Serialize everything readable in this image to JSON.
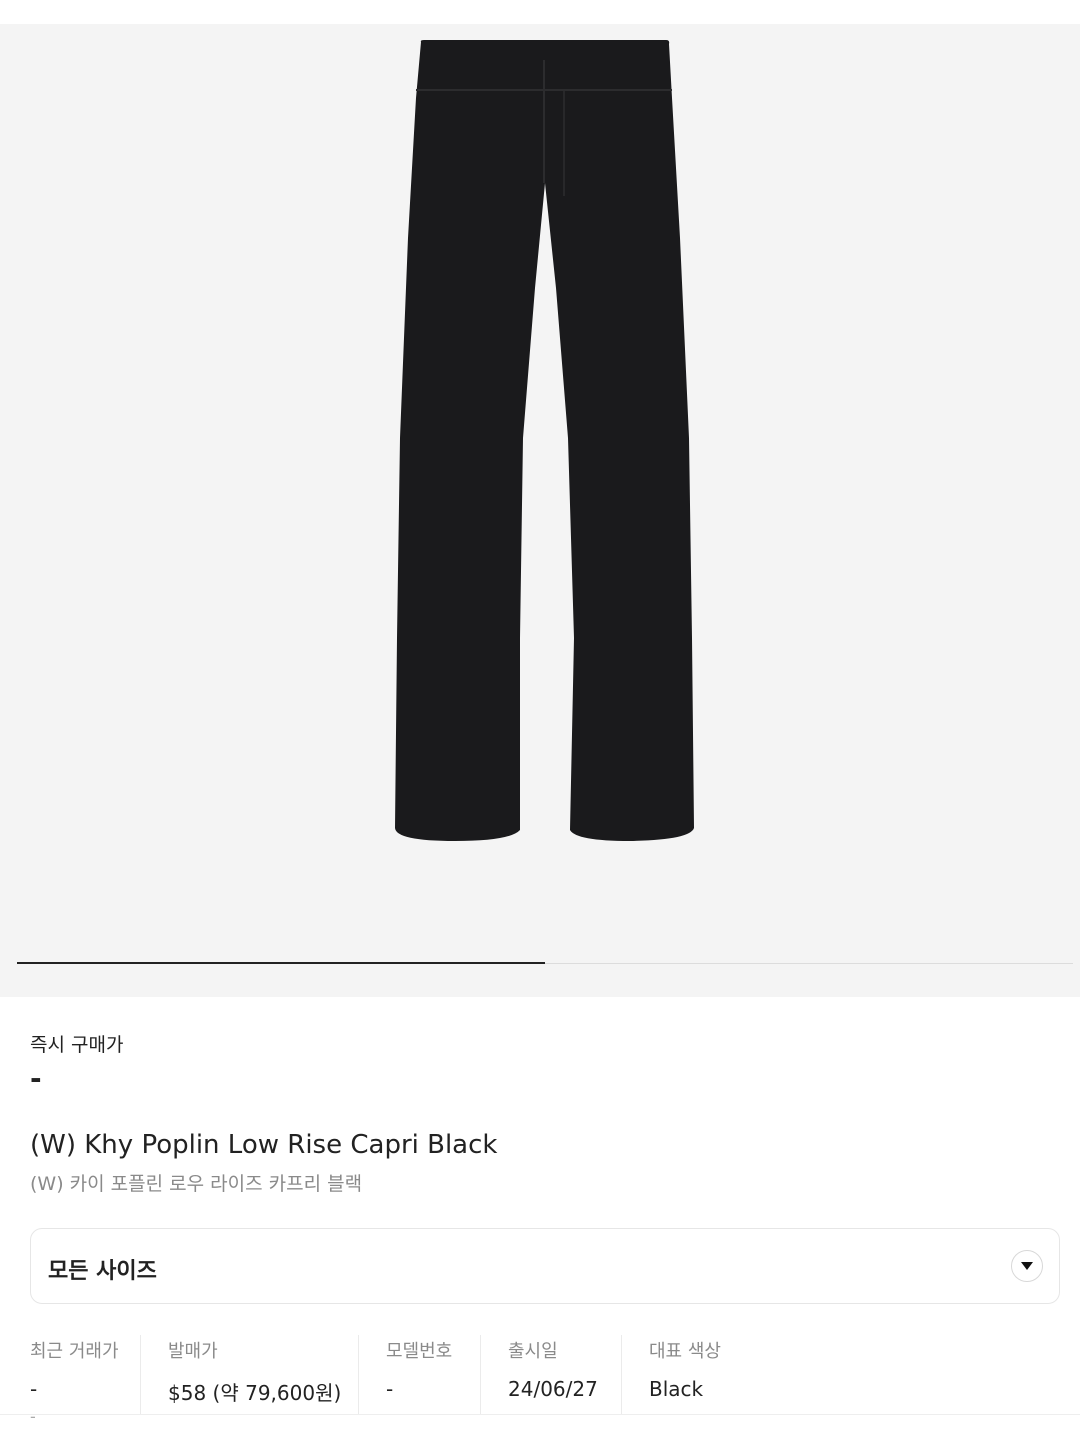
{
  "product": {
    "image_alt": "Black capri pants",
    "title_en": "(W) Khy Poplin Low Rise Capri Black",
    "title_ko": "(W) 카이 포플린 로우 라이즈 카프리 블랙"
  },
  "gallery": {
    "progress_fraction": 0.5
  },
  "instant_buy": {
    "label": "즉시 구매가",
    "value": "-"
  },
  "size_select": {
    "label": "모든 사이즈",
    "icon": "chevron-down-icon"
  },
  "info": {
    "recent_trade": {
      "label": "최근 거래가",
      "value": "-",
      "sub": "-"
    },
    "release_price": {
      "label": "발매가",
      "value": "$58 (약 79,600원)"
    },
    "model_number": {
      "label": "모델번호",
      "value": "-"
    },
    "release_date": {
      "label": "출시일",
      "value": "24/06/27"
    },
    "color": {
      "label": "대표 색상",
      "value": "Black"
    }
  }
}
